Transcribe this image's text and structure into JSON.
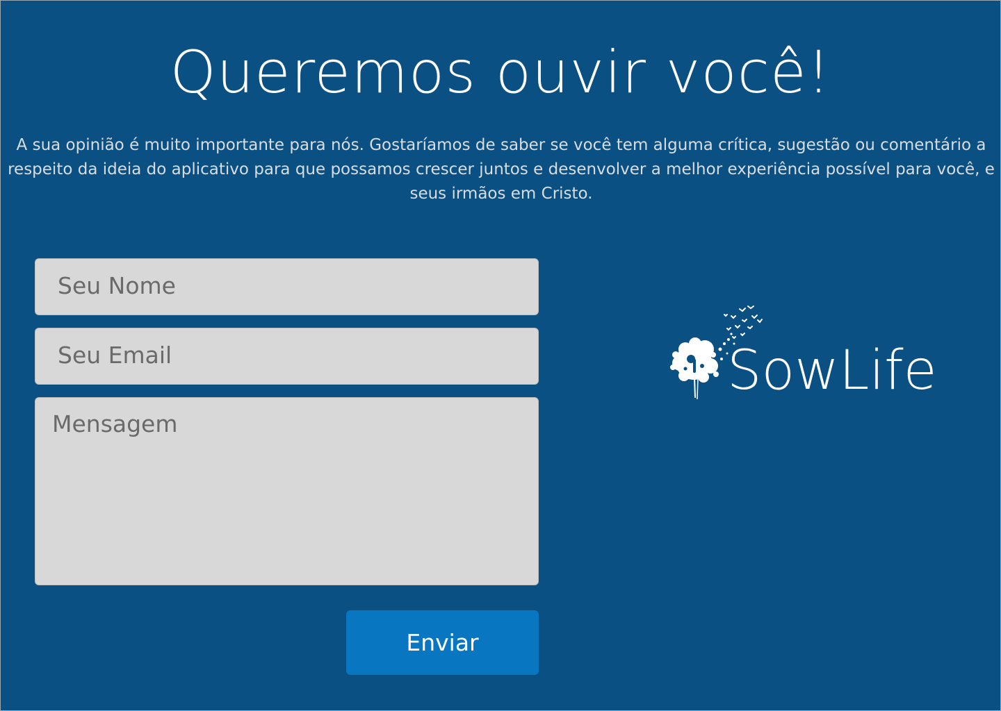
{
  "colors": {
    "background": "#0a5083",
    "field_background": "#d8d8d8",
    "button_background": "#0876c1",
    "text_light": "#ffffff"
  },
  "header": {
    "title": "Queremos ouvir você!",
    "intro": "A sua opinião é muito importante para nós. Gostaríamos de saber se você tem alguma crítica, sugestão ou comentário a respeito da ideia do aplicativo para que possamos crescer juntos e desenvolver a melhor experiência possível para você, e seus irmãos em Cristo."
  },
  "form": {
    "name_placeholder": "Seu Nome",
    "name_value": "",
    "email_placeholder": "Seu Email",
    "email_value": "",
    "message_placeholder": "Mensagem",
    "message_value": "",
    "submit_label": "Enviar"
  },
  "logo": {
    "name": "SowLife",
    "icon": "dandelion-birds-icon"
  }
}
